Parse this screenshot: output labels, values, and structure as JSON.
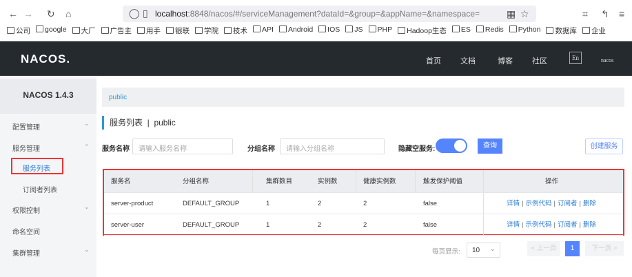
{
  "browser": {
    "url_host": "localhost",
    "url_rest": ":8848/nacos/#/serviceManagement?dataId=&group=&appName=&namespace=",
    "bookmarks": [
      "公司",
      "google",
      "大厂",
      "广告主",
      "用手",
      "银联",
      "学院",
      "技术",
      "API",
      "Android",
      "IOS",
      "JS",
      "PHP",
      "Hadoop生态",
      "ES",
      "Redis",
      "Python",
      "数据库",
      "企业"
    ]
  },
  "header": {
    "logo": "NACOS.",
    "nav": [
      "首页",
      "文档",
      "博客",
      "社区"
    ],
    "lang": "En",
    "user": "nacos"
  },
  "sidebar": {
    "title": "NACOS 1.4.3",
    "items": [
      {
        "label": "配置管理",
        "chev": "⌄"
      },
      {
        "label": "服务管理",
        "chev": "⌃"
      },
      {
        "label": "服务列表"
      },
      {
        "label": "订阅者列表"
      },
      {
        "label": "权限控制",
        "chev": "⌄"
      },
      {
        "label": "命名空间"
      },
      {
        "label": "集群管理",
        "chev": "⌄"
      }
    ]
  },
  "main": {
    "breadcrumb": "public",
    "title": "服务列表  |  public",
    "search": {
      "service_label": "服务名称",
      "service_placeholder": "请输入服务名称",
      "group_label": "分组名称",
      "group_placeholder": "请输入分组名称",
      "hide_empty_label": "隐藏空服务:",
      "hide_empty_on": true,
      "query": "查询",
      "create": "创建服务"
    },
    "table": {
      "headers": [
        "服务名",
        "分组名称",
        "集群数目",
        "实例数",
        "健康实例数",
        "触发保护阈值",
        "操作"
      ],
      "rows": [
        [
          "server-product",
          "DEFAULT_GROUP",
          "1",
          "2",
          "2",
          "false"
        ],
        [
          "server-user",
          "DEFAULT_GROUP",
          "1",
          "2",
          "2",
          "false"
        ]
      ],
      "actions": [
        "详情",
        "示例代码",
        "订阅者",
        "删除"
      ]
    },
    "pagination": {
      "per_page_label": "每页显示:",
      "per_page": "10",
      "prev": "< 上一页",
      "page": "1",
      "next": "下一页 >"
    }
  }
}
